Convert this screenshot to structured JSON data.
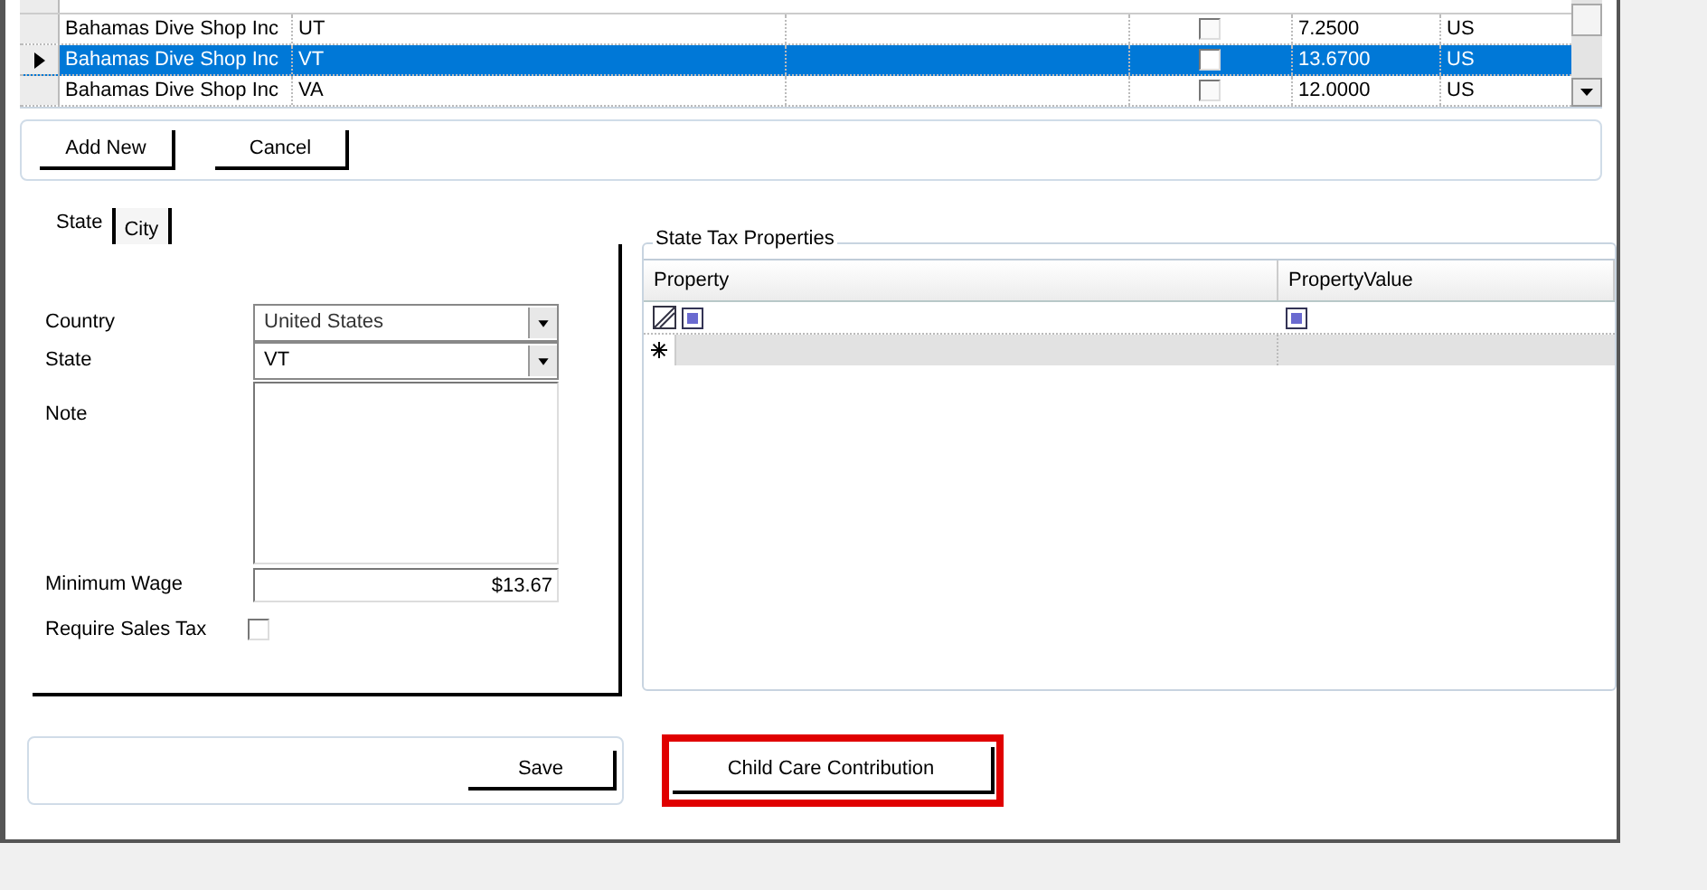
{
  "grid": {
    "rows": [
      {
        "company": "Bahamas Dive Shop Inc",
        "state": "UT",
        "checked": false,
        "wage": "7.2500",
        "country": "US",
        "selected": false
      },
      {
        "company": "Bahamas Dive Shop Inc",
        "state": "VT",
        "checked": false,
        "wage": "13.6700",
        "country": "US",
        "selected": true
      },
      {
        "company": "Bahamas Dive Shop Inc",
        "state": "VA",
        "checked": false,
        "wage": "12.0000",
        "country": "US",
        "selected": false
      }
    ]
  },
  "grid_buttons": [
    "Add New",
    "Cancel"
  ],
  "tabs": [
    {
      "label": "State",
      "selected": true
    },
    {
      "label": "City",
      "selected": false
    }
  ],
  "form": {
    "country_label": "Country",
    "country": "United States",
    "state_label": "State",
    "state": "VT",
    "note_label": "Note",
    "wage_label": "Minimum Wage",
    "wage": "$13.67",
    "sales_tax_label": "Require Sales Tax",
    "sales_tax": false
  },
  "tax_properties": {
    "title": "State Tax Properties",
    "columns": [
      "Property",
      "PropertyValue"
    ]
  },
  "save_button": "Save",
  "child_care_button": {
    "label": "Child Care Contribution",
    "highlighted": true
  }
}
